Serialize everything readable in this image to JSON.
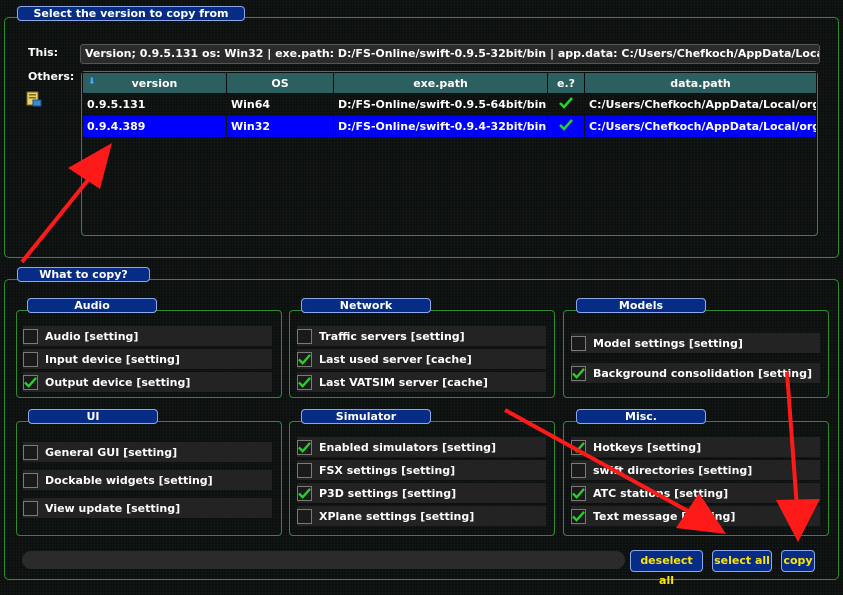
{
  "source_section": {
    "legend": "Select the version to copy from",
    "this_label": "This:",
    "this_value": "Version; 0.9.5.131 os: Win32 | exe.path: D:/FS-Online/swift-0.9.5-32bit/bin | app.data: C:/Users/Chefkoch/AppData/Local/org.swift-project/D",
    "others_label": "Others:",
    "table": {
      "columns": [
        "version",
        "OS",
        "exe.path",
        "e.?",
        "data.path"
      ],
      "rows": [
        {
          "version": "0.9.5.131",
          "os": "Win64",
          "exe_path": "D:/FS-Online/swift-0.9.5-64bit/bin",
          "exists": true,
          "data_path": "C:/Users/Chefkoch/AppData/Local/org.swi"
        },
        {
          "version": "0.9.4.389",
          "os": "Win32",
          "exe_path": "D:/FS-Online/swift-0.9.4-32bit/bin",
          "exists": true,
          "data_path": "C:/Users/Chefkoch/AppData/Local/org.swi",
          "selected": true
        }
      ]
    }
  },
  "copy_section": {
    "legend": "What to copy?",
    "groups": {
      "audio": {
        "title": "Audio",
        "items": [
          {
            "label": "Audio [setting]",
            "checked": false
          },
          {
            "label": "Input device [setting]",
            "checked": false
          },
          {
            "label": "Output device [setting]",
            "checked": true
          }
        ]
      },
      "network": {
        "title": "Network",
        "items": [
          {
            "label": "Traffic servers [setting]",
            "checked": false
          },
          {
            "label": "Last used server [cache]",
            "checked": true
          },
          {
            "label": "Last VATSIM server [cache]",
            "checked": true
          }
        ]
      },
      "models": {
        "title": "Models",
        "items": [
          {
            "label": "Model settings [setting]",
            "checked": false
          },
          {
            "label": "Background consolidation [setting]",
            "checked": true
          }
        ]
      },
      "ui": {
        "title": "UI",
        "items": [
          {
            "label": "General GUI [setting]",
            "checked": false
          },
          {
            "label": "Dockable widgets [setting]",
            "checked": false
          },
          {
            "label": "View update [setting]",
            "checked": false
          }
        ]
      },
      "simulator": {
        "title": "Simulator",
        "items": [
          {
            "label": "Enabled simulators [setting]",
            "checked": true
          },
          {
            "label": "FSX settings [setting]",
            "checked": false
          },
          {
            "label": "P3D settings [setting]",
            "checked": true
          },
          {
            "label": "XPlane settings [setting]",
            "checked": false
          }
        ]
      },
      "misc": {
        "title": "Misc.",
        "items": [
          {
            "label": "Hotkeys [setting]",
            "checked": true
          },
          {
            "label": "swift directories [setting]",
            "checked": false
          },
          {
            "label": "ATC stations [setting]",
            "checked": true
          },
          {
            "label": "Text message [setting]",
            "checked": true
          }
        ]
      }
    }
  },
  "actions": {
    "deselect_all": "deselect all",
    "select_all": "select all",
    "copy": "copy"
  },
  "colors": {
    "accent_blue": "#062c85",
    "button_text": "#ffe400",
    "frame_green": "#2f8b2f",
    "annotation_red": "#ff1a1a",
    "check_green": "#2bd12b"
  }
}
